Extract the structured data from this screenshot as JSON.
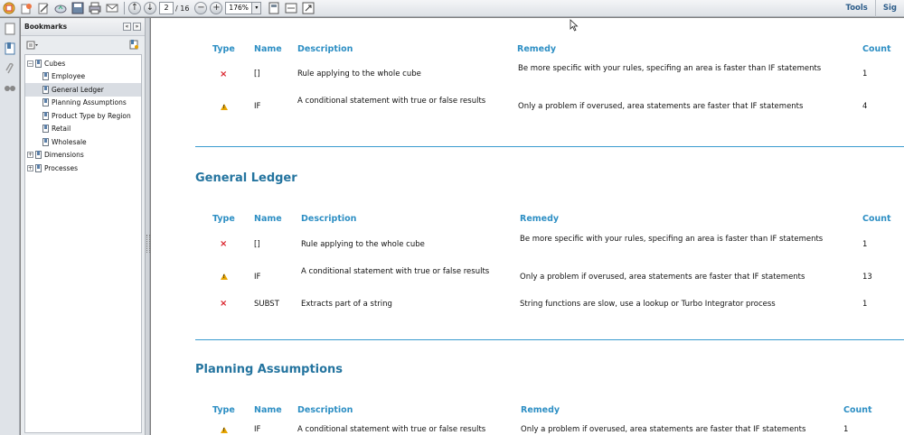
{
  "toolbar": {
    "page_current": "2",
    "page_total": "/ 16",
    "zoom": "176%",
    "tools_label": "Tools",
    "sign_label": "Sig"
  },
  "bookmarks": {
    "title": "Bookmarks",
    "items": [
      {
        "label": "Cubes",
        "level": 0,
        "expander": "−"
      },
      {
        "label": "Employee",
        "level": 1
      },
      {
        "label": "General Ledger",
        "level": 1,
        "selected": true
      },
      {
        "label": "Planning Assumptions",
        "level": 1
      },
      {
        "label": "Product Type by Region",
        "level": 1
      },
      {
        "label": "Retail",
        "level": 1
      },
      {
        "label": "Wholesale",
        "level": 1
      },
      {
        "label": "Dimensions",
        "level": 0,
        "expander": "+"
      },
      {
        "label": "Processes",
        "level": 0,
        "expander": "+"
      }
    ]
  },
  "document": {
    "table1": {
      "headers": {
        "type": "Type",
        "name": "Name",
        "description": "Description",
        "remedy": "Remedy",
        "count": "Count"
      },
      "rows": [
        {
          "type": "error",
          "name": "[]",
          "description": "Rule applying to the whole cube",
          "remedy": "Be more specific with your rules, specifing an area is faster than IF statements",
          "count": "1"
        },
        {
          "type": "warning",
          "name": "IF",
          "description": "A conditional statement with true or false results",
          "remedy": "Only a problem if overused, area statements are faster that IF statements",
          "count": "4"
        }
      ]
    },
    "section2": {
      "title": "General Ledger",
      "headers": {
        "type": "Type",
        "name": "Name",
        "description": "Description",
        "remedy": "Remedy",
        "count": "Count"
      },
      "rows": [
        {
          "type": "error",
          "name": "[]",
          "description": "Rule applying to the whole cube",
          "remedy": "Be more specific with your rules, specifing an area is faster than IF statements",
          "count": "1"
        },
        {
          "type": "warning",
          "name": "IF",
          "description": "A conditional statement with true or false results",
          "remedy": "Only a problem if overused, area statements are faster that IF statements",
          "count": "13"
        },
        {
          "type": "error",
          "name": "SUBST",
          "description": "Extracts part of a string",
          "remedy": "String functions are slow, use a lookup or Turbo Integrator process",
          "count": "1"
        }
      ]
    },
    "section3": {
      "title": "Planning Assumptions",
      "headers": {
        "type": "Type",
        "name": "Name",
        "description": "Description",
        "remedy": "Remedy",
        "count": "Count"
      },
      "rows": [
        {
          "type": "warning",
          "name": "IF",
          "description": "A conditional statement with true or false results",
          "remedy": "Only a problem if overused, area statements are faster that IF statements",
          "count": "1"
        }
      ]
    }
  }
}
